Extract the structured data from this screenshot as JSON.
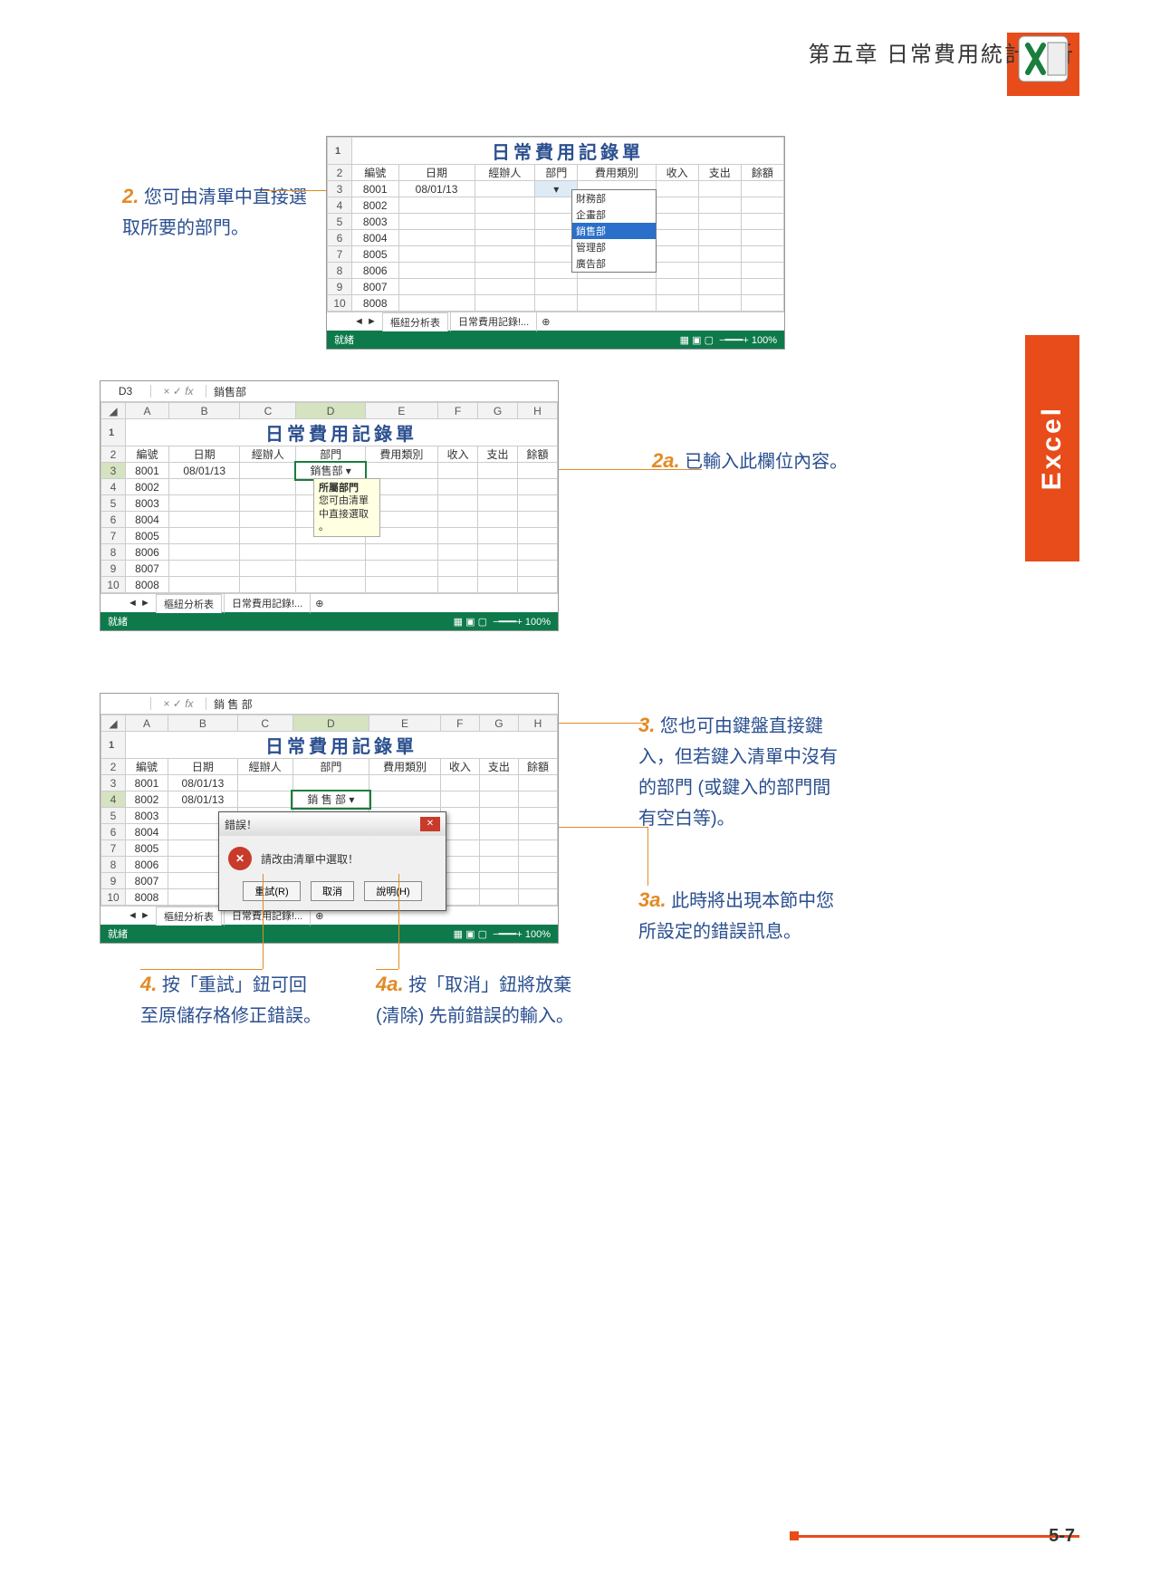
{
  "header": {
    "chapter": "第五章  日常費用統計分析"
  },
  "side_tab": "Excel",
  "callouts": {
    "c2": {
      "num": "2.",
      "text": "您可由清單中直接選取所要的部門。"
    },
    "c2a": {
      "num": "2a.",
      "text": "已輸入此欄位內容。"
    },
    "c3": {
      "num": "3.",
      "text": "您也可由鍵盤直接鍵入，但若鍵入清單中沒有的部門 (或鍵入的部門間有空白等)。"
    },
    "c3a": {
      "num": "3a.",
      "text": "此時將出現本節中您所設定的錯誤訊息。"
    },
    "c4": {
      "num": "4.",
      "text": "按「重試」鈕可回至原儲存格修正錯誤。"
    },
    "c4a": {
      "num": "4a.",
      "text": "按「取消」鈕將放棄 (清除) 先前錯誤的輸入。"
    }
  },
  "shot1": {
    "title": "日常費用記錄單",
    "headers": [
      "編號",
      "日期",
      "經辦人",
      "部門",
      "費用類別",
      "收入",
      "支出",
      "餘額"
    ],
    "rows": [
      {
        "n": "8001",
        "d": "08/01/13"
      },
      {
        "n": "8002"
      },
      {
        "n": "8003"
      },
      {
        "n": "8004"
      },
      {
        "n": "8005"
      },
      {
        "n": "8006"
      },
      {
        "n": "8007"
      },
      {
        "n": "8008"
      }
    ],
    "dropdown": [
      "財務部",
      "企畫部",
      "銷售部",
      "管理部",
      "廣告部"
    ],
    "tabs": [
      "樞紐分析表",
      "日常費用記錄!..."
    ],
    "status": "就緒",
    "zoom": "100%"
  },
  "shot2": {
    "cols": [
      "A",
      "B",
      "C",
      "D",
      "E",
      "F",
      "G",
      "H"
    ],
    "cell_ref": "D3",
    "fx_value": "銷售部",
    "title": "日常費用記錄單",
    "headers": [
      "編號",
      "日期",
      "經辦人",
      "部門",
      "費用類別",
      "收入",
      "支出",
      "餘額"
    ],
    "rows": [
      {
        "n": "8001",
        "d": "08/01/13",
        "dept": "銷售部"
      },
      {
        "n": "8002"
      },
      {
        "n": "8003"
      },
      {
        "n": "8004"
      },
      {
        "n": "8005"
      },
      {
        "n": "8006"
      },
      {
        "n": "8007"
      },
      {
        "n": "8008"
      }
    ],
    "tooltip": {
      "t": "所屬部門",
      "l1": "您可由清單",
      "l2": "中直接選取",
      "l3": "。"
    },
    "tabs": [
      "樞紐分析表",
      "日常費用記錄!..."
    ],
    "status": "就緒",
    "zoom": "100%"
  },
  "shot3": {
    "cols": [
      "A",
      "B",
      "C",
      "D",
      "E",
      "F",
      "G",
      "H"
    ],
    "fx_value": "銷 售 部",
    "title": "日常費用記錄單",
    "headers": [
      "編號",
      "日期",
      "經辦人",
      "部門",
      "費用類別",
      "收入",
      "支出",
      "餘額"
    ],
    "rows": [
      {
        "n": "8001",
        "d": "08/01/13"
      },
      {
        "n": "8002",
        "d": "08/01/13",
        "dept": "銷 售 部"
      },
      {
        "n": "8003"
      },
      {
        "n": "8004"
      },
      {
        "n": "8005"
      },
      {
        "n": "8006"
      },
      {
        "n": "8007"
      },
      {
        "n": "8008"
      }
    ],
    "dialog": {
      "title": "錯誤！",
      "msg": "請改由清單中選取！",
      "retry": "重試(R)",
      "cancel": "取消",
      "help": "說明(H)"
    },
    "tabs": [
      "樞紐分析表",
      "日常費用記錄!..."
    ],
    "status": "就緒",
    "zoom": "100%"
  },
  "footer": {
    "page": "5-7"
  }
}
